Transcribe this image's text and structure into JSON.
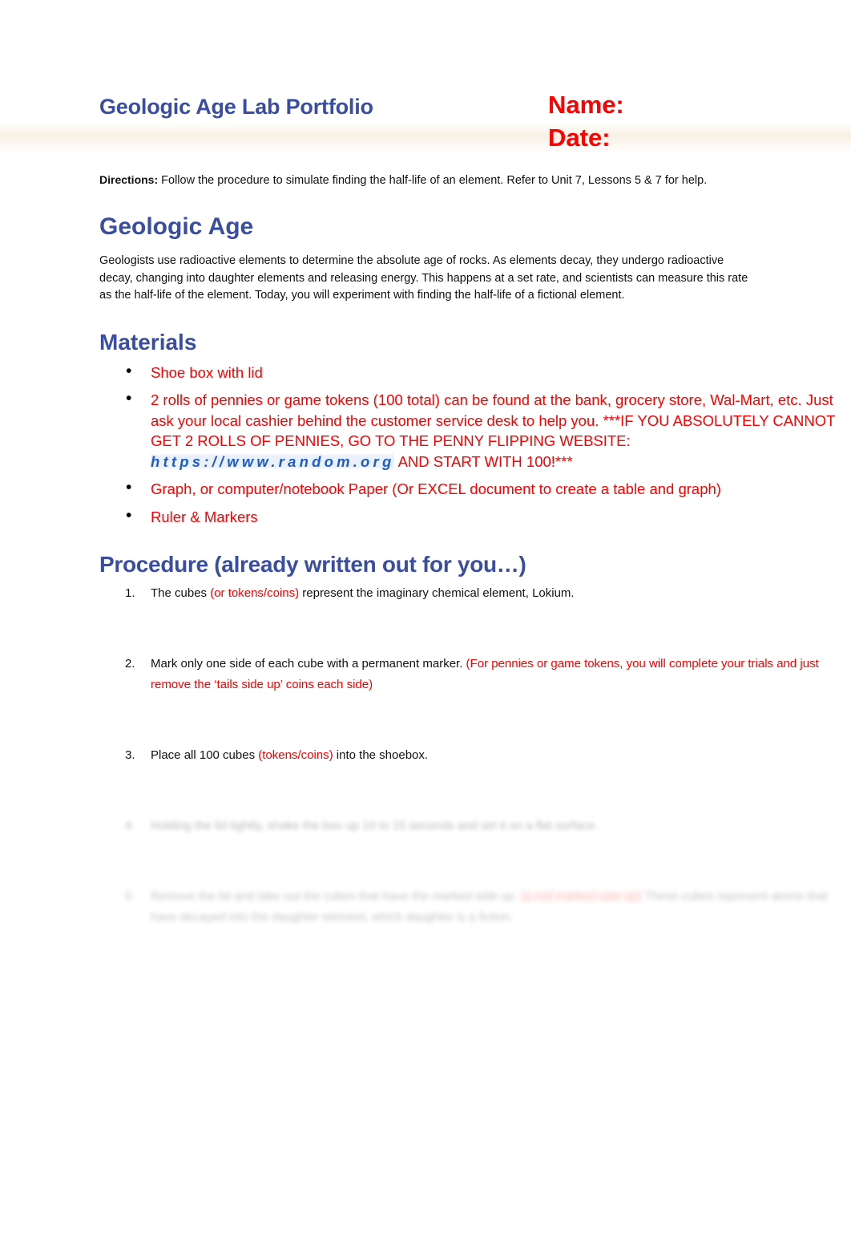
{
  "document": {
    "title": "Geologic Age Lab Portfolio",
    "name_label": "Name:",
    "date_label": "Date:",
    "directions_label": "Directions:",
    "directions_text": " Follow the procedure to simulate finding the half-life of an element. Refer to Unit 7, Lessons 5 & 7 for help."
  },
  "colors": {
    "heading_blue": "#3A4EA1",
    "accent_red": "#FF0000",
    "link_blue": "#1F5CC6",
    "band_cream": "#F6EEE0",
    "body_black": "#111111"
  },
  "sections": {
    "geologic_age": {
      "heading": "Geologic Age",
      "paragraph": "Geologists use radioactive elements to determine the absolute age of rocks. As elements decay, they undergo radioactive decay, changing into daughter elements and releasing energy. This happens at a set rate, and scientists can measure this rate as the half-life of the element. Today, you will experiment with finding the half-life of a fictional element."
    },
    "materials": {
      "heading": "Materials",
      "items": [
        {
          "text": "Shoe box with lid"
        },
        {
          "text_before": "2 rolls of pennies or game tokens (100 total) can be found at the bank, grocery store, Wal-Mart, etc. Just ask your local cashier behind the customer service desk to help you. ***IF YOU ABSOLUTELY CANNOT GET 2 ROLLS OF PENNIES, GO TO THE PENNY FLIPPING WEBSITE: ",
          "url": "https://www.random.org",
          "text_after": " AND START WITH 100!***"
        },
        {
          "text": "Graph, or computer/notebook Paper (Or EXCEL document to create a table and graph)"
        },
        {
          "text": "Ruler & Markers"
        }
      ]
    },
    "procedure": {
      "heading": "Procedure (already written out for you…)",
      "steps": [
        {
          "before": "The cubes ",
          "red": "(or tokens/coins)",
          "after": " represent the imaginary chemical element, Lokium.",
          "state": "visible"
        },
        {
          "before": "Mark only one side of each cube with a permanent marker. ",
          "red": "(For pennies or game tokens, you will complete your trials and just remove the ‘tails side up’ coins each side)",
          "after": "",
          "state": "visible"
        },
        {
          "before": "Place all 100 cubes ",
          "red": "(tokens/coins)",
          "after": " into the shoebox.",
          "state": "visible"
        },
        {
          "before": "Holding the lid tightly, shake the box up 10 to 15 seconds and set it on a flat surface.",
          "red": "",
          "after": "",
          "state": "blurred"
        },
        {
          "before": "Remove the lid and take out the cubes that have the marked side up. ",
          "red": "(a red marked side up)",
          "after": " These cubes represent atoms that have decayed into the daughter element, which daughter is a fiction.",
          "state": "blurred"
        }
      ]
    }
  }
}
